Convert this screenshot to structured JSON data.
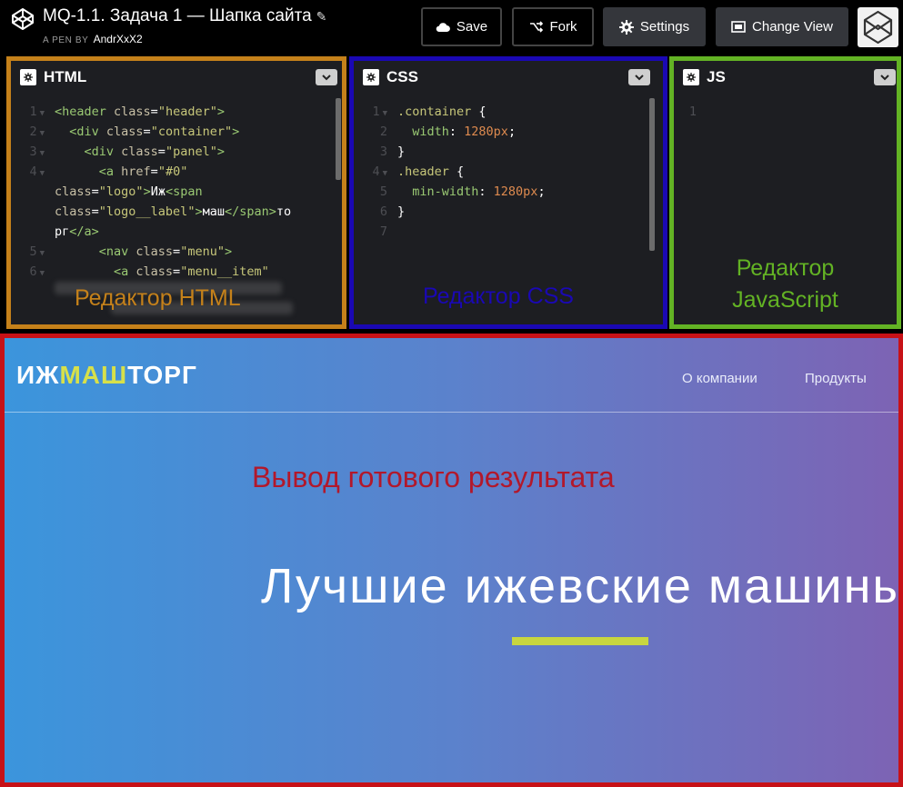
{
  "topbar": {
    "title": "MQ-1.1. Задача 1 — Шапка сайта",
    "pen_by": "A PEN BY",
    "author": "AndrXxX2",
    "buttons": {
      "save": "Save",
      "fork": "Fork",
      "settings": "Settings",
      "change_view": "Change View"
    }
  },
  "editors": {
    "html": {
      "title": "HTML",
      "label": "Редактор  HTML",
      "lines": [
        {
          "num": "1",
          "fold": true,
          "segs": [
            [
              "tag",
              "<header "
            ],
            [
              "attr",
              "class"
            ],
            [
              "plain",
              "="
            ],
            [
              "str",
              "\"header\""
            ],
            [
              "tag",
              ">"
            ]
          ]
        },
        {
          "num": "2",
          "fold": true,
          "segs": [
            [
              "tag",
              "  <div "
            ],
            [
              "attr",
              "class"
            ],
            [
              "plain",
              "="
            ],
            [
              "str",
              "\"container\""
            ],
            [
              "tag",
              ">"
            ]
          ]
        },
        {
          "num": "3",
          "fold": true,
          "segs": [
            [
              "tag",
              "    <div "
            ],
            [
              "attr",
              "class"
            ],
            [
              "plain",
              "="
            ],
            [
              "str",
              "\"panel\""
            ],
            [
              "tag",
              ">"
            ]
          ]
        },
        {
          "num": "4",
          "fold": true,
          "segs": [
            [
              "tag",
              "      <a "
            ],
            [
              "attr",
              "href"
            ],
            [
              "plain",
              "="
            ],
            [
              "str",
              "\"#0\""
            ]
          ]
        },
        {
          "num": "",
          "fold": false,
          "segs": [
            [
              "attr",
              "class"
            ],
            [
              "plain",
              "="
            ],
            [
              "str",
              "\"logo\""
            ],
            [
              "tag",
              ">"
            ],
            [
              "plain",
              "Иж"
            ],
            [
              "tag",
              "<span"
            ]
          ]
        },
        {
          "num": "",
          "fold": false,
          "segs": [
            [
              "attr",
              "class"
            ],
            [
              "plain",
              "="
            ],
            [
              "str",
              "\"logo__label\""
            ],
            [
              "tag",
              ">"
            ],
            [
              "plain",
              "маш"
            ],
            [
              "tag",
              "</span>"
            ],
            [
              "plain",
              "то"
            ]
          ]
        },
        {
          "num": "",
          "fold": false,
          "segs": [
            [
              "plain",
              "рг"
            ],
            [
              "tag",
              "</a>"
            ]
          ]
        },
        {
          "num": "5",
          "fold": true,
          "segs": [
            [
              "tag",
              "      <nav "
            ],
            [
              "attr",
              "class"
            ],
            [
              "plain",
              "="
            ],
            [
              "str",
              "\"menu\""
            ],
            [
              "tag",
              ">"
            ]
          ]
        },
        {
          "num": "6",
          "fold": true,
          "segs": [
            [
              "tag",
              "        <a "
            ],
            [
              "attr",
              "class"
            ],
            [
              "plain",
              "="
            ],
            [
              "str",
              "\"menu__item\""
            ]
          ]
        }
      ]
    },
    "css": {
      "title": "CSS",
      "label": "Редактор  CSS",
      "lines": [
        {
          "num": "1",
          "fold": true,
          "segs": [
            [
              "sel",
              ".container "
            ],
            [
              "plain",
              "{"
            ]
          ]
        },
        {
          "num": "2",
          "fold": false,
          "segs": [
            [
              "prop",
              "  width"
            ],
            [
              "plain",
              ": "
            ],
            [
              "num",
              "1280px"
            ],
            [
              "plain",
              ";"
            ]
          ]
        },
        {
          "num": "3",
          "fold": false,
          "segs": [
            [
              "plain",
              "}"
            ]
          ]
        },
        {
          "num": "4",
          "fold": true,
          "segs": [
            [
              "sel",
              ".header "
            ],
            [
              "plain",
              "{"
            ]
          ]
        },
        {
          "num": "5",
          "fold": false,
          "segs": [
            [
              "prop",
              "  min-width"
            ],
            [
              "plain",
              ": "
            ],
            [
              "num",
              "1280px"
            ],
            [
              "plain",
              ";"
            ]
          ]
        },
        {
          "num": "6",
          "fold": false,
          "segs": [
            [
              "plain",
              "}"
            ]
          ]
        },
        {
          "num": "7",
          "fold": false,
          "segs": []
        }
      ]
    },
    "js": {
      "title": "JS",
      "label_line1": "Редактор",
      "label_line2": "JavaScript",
      "lines": [
        {
          "num": "1",
          "fold": false,
          "segs": []
        }
      ]
    }
  },
  "preview": {
    "logo_left": "ИЖ",
    "logo_mid": "МАШ",
    "logo_right": "ТОРГ",
    "menu": [
      "О компании",
      "Продукты"
    ],
    "output_label": "Вывод готового результата",
    "hero": "Лучшие ижевские машины"
  },
  "colors": {
    "html_border": "#c5811a",
    "css_border": "#1a08b4",
    "js_border": "#63b324",
    "preview_border": "#c71117",
    "logo_accent": "#d7e04a",
    "hero_bar": "#c8d640"
  }
}
